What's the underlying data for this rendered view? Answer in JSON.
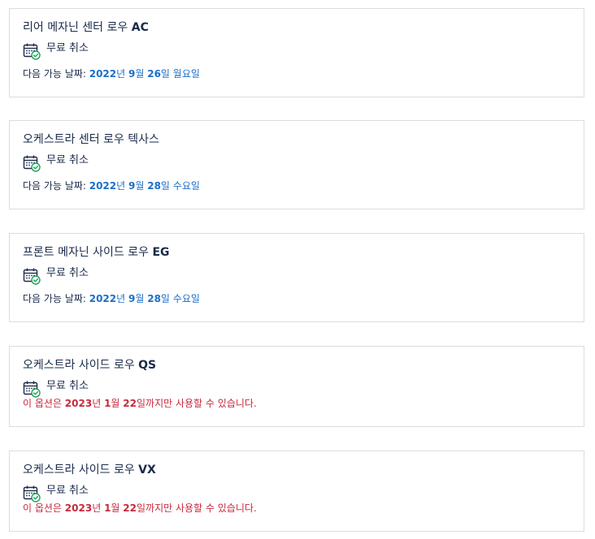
{
  "colors": {
    "text": "#1a2b49",
    "border": "#d9dce1",
    "date_blue": "#1a6fc9",
    "warning_red": "#c8283c",
    "icon_green": "#1e9e5a"
  },
  "options": [
    {
      "title_prefix": "리어 메자닌 센터 로우 ",
      "title_bold": "AC",
      "cancel_icon": "calendar-check-icon",
      "cancel_label": "무료 취소",
      "avail_prefix": "다음 가능 날짜: ",
      "date_parts": [
        "2022",
        "년 ",
        "9",
        "월 ",
        "26",
        "일 월요일"
      ]
    },
    {
      "title_prefix": "오케스트라 센터 로우 텍사스",
      "title_bold": "",
      "cancel_icon": "calendar-check-icon",
      "cancel_label": "무료 취소",
      "avail_prefix": "다음 가능 날짜: ",
      "date_parts": [
        "2022",
        "년 ",
        "9",
        "월 ",
        "28",
        "일 수요일"
      ]
    },
    {
      "title_prefix": "프론트 메자닌 사이드 로우 ",
      "title_bold": "EG",
      "cancel_icon": "calendar-check-icon",
      "cancel_label": "무료 취소",
      "avail_prefix": "다음 가능 날짜: ",
      "date_parts": [
        "2022",
        "년 ",
        "9",
        "월 ",
        "28",
        "일 수요일"
      ]
    },
    {
      "title_prefix": "오케스트라 사이드 로우 ",
      "title_bold": "QS",
      "cancel_icon": "calendar-check-icon",
      "cancel_label": "무료 취소",
      "limit_parts": [
        "이 옵션은 ",
        "2023",
        "년 ",
        "1",
        "월 ",
        "22",
        "일까지만 사용할 수 있습니다."
      ]
    },
    {
      "title_prefix": "오케스트라 사이드 로우 ",
      "title_bold": "VX",
      "cancel_icon": "calendar-check-icon",
      "cancel_label": "무료 취소",
      "limit_parts": [
        "이 옵션은 ",
        "2023",
        "년 ",
        "1",
        "월 ",
        "22",
        "일까지만 사용할 수 있습니다."
      ]
    }
  ]
}
